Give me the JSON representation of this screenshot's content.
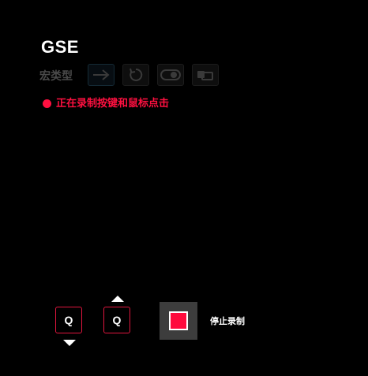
{
  "header": {
    "title": "GSE"
  },
  "macro_type": {
    "label": "宏类型",
    "options": [
      {
        "icon": "arrow-right-icon",
        "selected": true
      },
      {
        "icon": "repeat-icon",
        "selected": false
      },
      {
        "icon": "toggle-icon",
        "selected": false
      },
      {
        "icon": "multi-key-icon",
        "selected": false
      }
    ]
  },
  "status": {
    "text": "正在录制按键和鼠标点击",
    "color": "#ff1040"
  },
  "recorded_events": [
    {
      "key": "Q",
      "direction": "down"
    },
    {
      "key": "Q",
      "direction": "up"
    }
  ],
  "controls": {
    "stop_label": "停止录制",
    "stop_color": "#ff0a3c"
  }
}
